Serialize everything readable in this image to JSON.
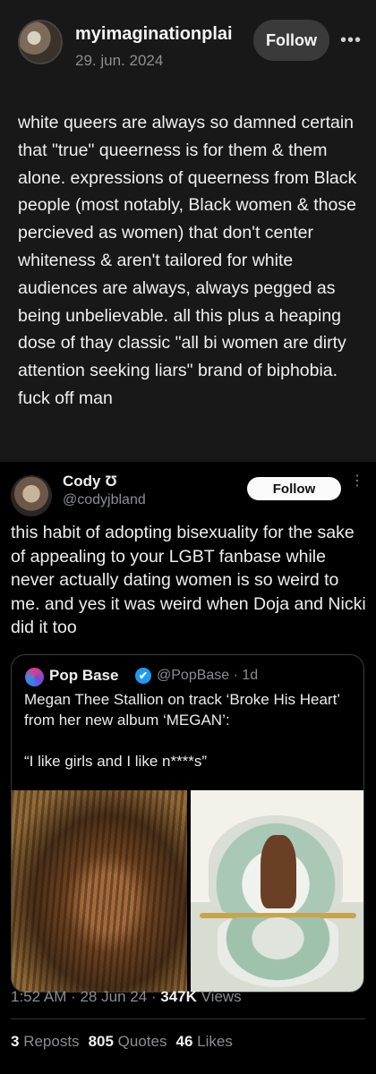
{
  "progress": {
    "value": 0.17,
    "color": "#3b82f6"
  },
  "threads_post": {
    "username": "myimaginationplai",
    "date": "29. jun. 2024",
    "follow_label": "Follow",
    "more_icon": "•••",
    "text": "white queers are always so damned certain that \"true\" queerness is for them & them alone. expressions of queerness from Black people (most notably, Black women & those percieved as women) that don't center whiteness & aren't tailored for white audiences are always, always pegged as being unbelievable. all this plus a heaping dose of thay classic \"all bi women are dirty attention seeking liars\" brand of biphobia. fuck off man"
  },
  "tweet": {
    "name": "Cody Ʊ",
    "handle": "@codyjbland",
    "follow_label": "Follow",
    "more_icon": "⋮",
    "text": "this habit of adopting bisexuality for the sake of appealing to your LGBT fanbase while never actually dating women is so weird to me. and yes it was weird when Doja and Nicki did it too",
    "quote": {
      "name": "Pop Base",
      "verified_icon": "✔",
      "meta": "@PopBase · 1d",
      "text": "Megan Thee Stallion on track ‘Broke His Heart’ from her new album ‘MEGAN’:",
      "quote_line": "“I like girls and I like n****s”"
    },
    "time": "1:52 AM · 28 Jun 24 · ",
    "views_count": "347K",
    "views_label": " Views",
    "reposts_count": "3",
    "reposts_label": " Reposts",
    "quotes_count": "805",
    "quotes_label": " Quotes",
    "likes_count": "46",
    "likes_label": " Likes"
  }
}
